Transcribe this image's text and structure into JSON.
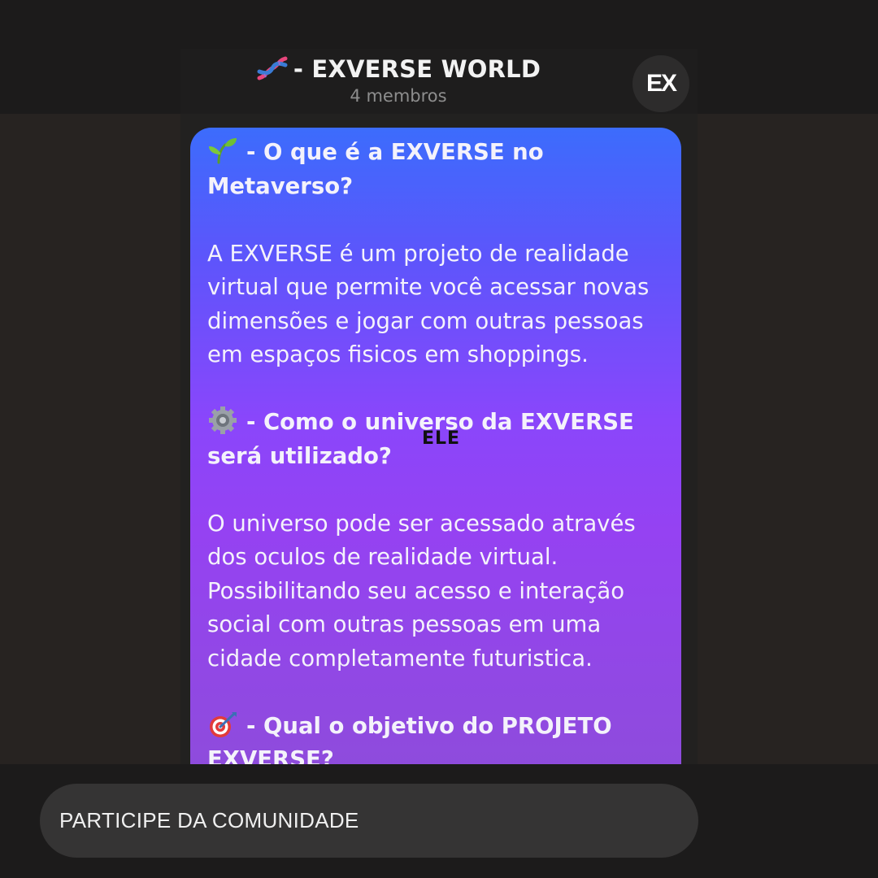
{
  "header": {
    "title": "- EXVERSE WORLD",
    "subtitle": "4 membros",
    "title_icon": "dna-icon",
    "avatar_text": "EX"
  },
  "message": {
    "sections": [
      {
        "icon": "seedling-icon",
        "heading_line1": "- O que é a EXVERSE no",
        "heading_line2": "Metaverso?",
        "body_lines": [
          "A EXVERSE é um projeto de realidade",
          "virtual que permite você acessar novas",
          "dimensões e jogar com outras pessoas",
          "em espaços fisicos em shoppings."
        ]
      },
      {
        "icon": "gear-icon",
        "heading_line1": "- Como o universo da EXVERSE",
        "heading_line2": "será utilizado?",
        "body_lines": [
          "O universo pode ser acessado através",
          "dos oculos de realidade virtual.",
          "Possibilitando seu acesso e interação",
          "social com outras pessoas em uma",
          "cidade completamente futuristica."
        ]
      },
      {
        "icon": "target-icon",
        "heading_line1": "- Qual o objetivo do PROJETO",
        "heading_line2": "EXVERSE?"
      }
    ]
  },
  "overlay_label": "ELE",
  "cta": {
    "label": "PARTICIPE DA COMUNIDADE"
  },
  "colors": {
    "bubble_top": "#3c6cfc",
    "bubble_mid": "#9542f2",
    "bubble_bottom": "#8e4cdb",
    "background": "#1c1b1b"
  }
}
